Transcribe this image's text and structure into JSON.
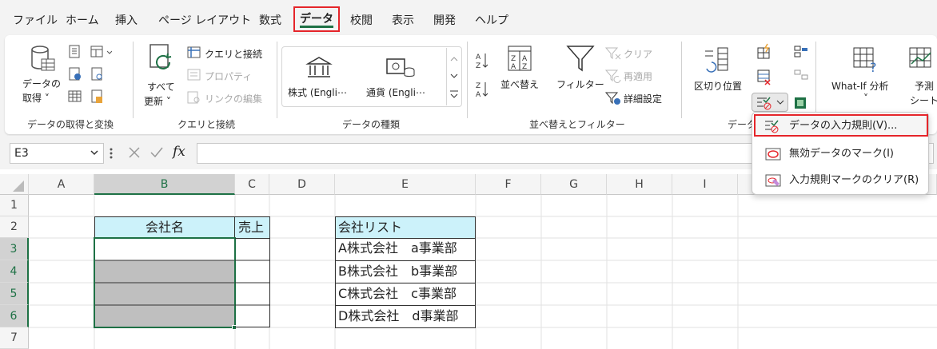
{
  "tabs": [
    "ファイル",
    "ホーム",
    "挿入",
    "ページ レイアウト",
    "数式",
    "データ",
    "校閲",
    "表示",
    "開発",
    "ヘルプ"
  ],
  "ribbon": {
    "get_data": {
      "label_line1": "データの",
      "label_line2": "取得 ˅",
      "group": "データの取得と変換"
    },
    "queries": {
      "refresh_line1": "すべて",
      "refresh_line2": "更新 ˅",
      "queries_connections": "クエリと接続",
      "properties": "プロパティ",
      "edit_links": "リンクの編集",
      "group": "クエリと接続"
    },
    "datatypes": {
      "stocks": "株式 (Engli⋯",
      "currency": "通貨 (Engli⋯",
      "group": "データの種類"
    },
    "sort_filter": {
      "sort": "並べ替え",
      "filter": "フィルター",
      "clear": "クリア",
      "reapply": "再適用",
      "advanced": "詳細設定",
      "group": "並べ替えとフィルター"
    },
    "tools": {
      "text_to_columns": "区切り位置",
      "group": "データ"
    },
    "forecast": {
      "whatif": "What-If 分析",
      "whatif_arrow": "˅",
      "forecast_line1": "予測",
      "forecast_line2": "シート"
    }
  },
  "formula_bar": {
    "name_box": "E3",
    "fx": "fx"
  },
  "grid": {
    "columns": [
      "A",
      "B",
      "C",
      "D",
      "E",
      "F",
      "G",
      "H",
      "I"
    ],
    "rows": [
      "1",
      "2",
      "3",
      "4",
      "5",
      "6",
      "7"
    ],
    "b2": "会社名",
    "c2": "売上",
    "e2": "会社リスト",
    "company_list": [
      "A株式会社　a事業部",
      "B株式会社　b事業部",
      "C株式会社　c事業部",
      "D株式会社　d事業部"
    ]
  },
  "dropdown": {
    "items": [
      "データの入力規則(V)...",
      "無効データのマーク(I)",
      "入力規則マークのクリア(R)"
    ]
  },
  "colors": {
    "accent": "#1e7145",
    "highlight": "#e5252a",
    "header_fill": "#ccf2fa",
    "gray_fill": "#bfbfbf"
  }
}
